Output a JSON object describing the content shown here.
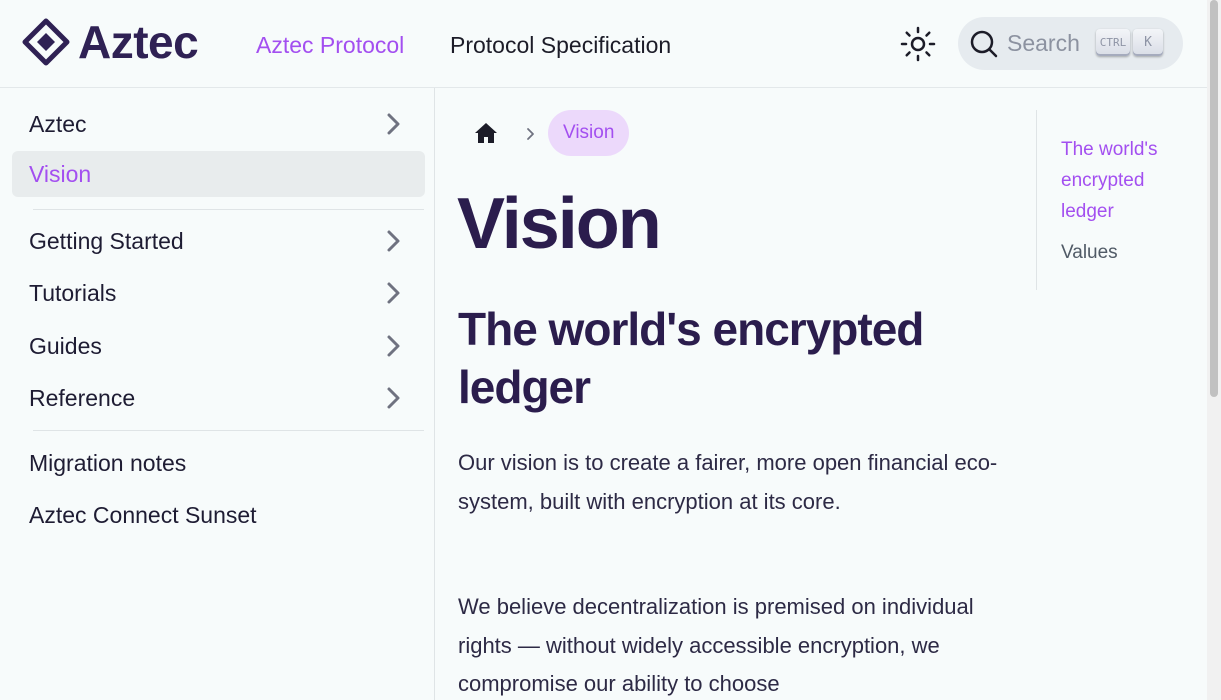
{
  "brand": {
    "name": "Aztec",
    "logo_icon": "aztec-diamond-logo"
  },
  "nav": {
    "links": [
      {
        "label": "Aztec Protocol",
        "active": true
      },
      {
        "label": "Protocol Specification",
        "active": false
      }
    ],
    "theme_icon": "sun-icon"
  },
  "search": {
    "placeholder": "Search",
    "shortcut_ctrl": "CTRL",
    "shortcut_key": "K"
  },
  "sidebar": {
    "items": [
      {
        "label": "Aztec",
        "expandable": true,
        "active": false
      },
      {
        "label": "Vision",
        "expandable": false,
        "active": true
      },
      {
        "label": "Getting Started",
        "expandable": true,
        "active": false
      },
      {
        "label": "Tutorials",
        "expandable": true,
        "active": false
      },
      {
        "label": "Guides",
        "expandable": true,
        "active": false
      },
      {
        "label": "Reference",
        "expandable": true,
        "active": false
      },
      {
        "label": "Migration notes",
        "expandable": false,
        "active": false
      },
      {
        "label": "Aztec Connect Sunset",
        "expandable": false,
        "active": false
      }
    ]
  },
  "breadcrumb": {
    "home_icon": "home-icon",
    "current": "Vision"
  },
  "main": {
    "title": "Vision",
    "section_heading": "The world's encrypted ledger",
    "paragraphs": [
      "Our vision is to create a fairer, more open financial eco-system, built with encryption at its core.",
      "We believe decentralization is premised on individual rights — without widely accessible encryption, we compromise our ability to choose"
    ]
  },
  "toc": {
    "items": [
      {
        "label": "The world's encrypted ledger",
        "active": true
      },
      {
        "label": "Values",
        "active": false
      }
    ]
  },
  "colors": {
    "accent": "#a34ff0",
    "title": "#2b1d4d",
    "background": "#f7fbfb"
  }
}
